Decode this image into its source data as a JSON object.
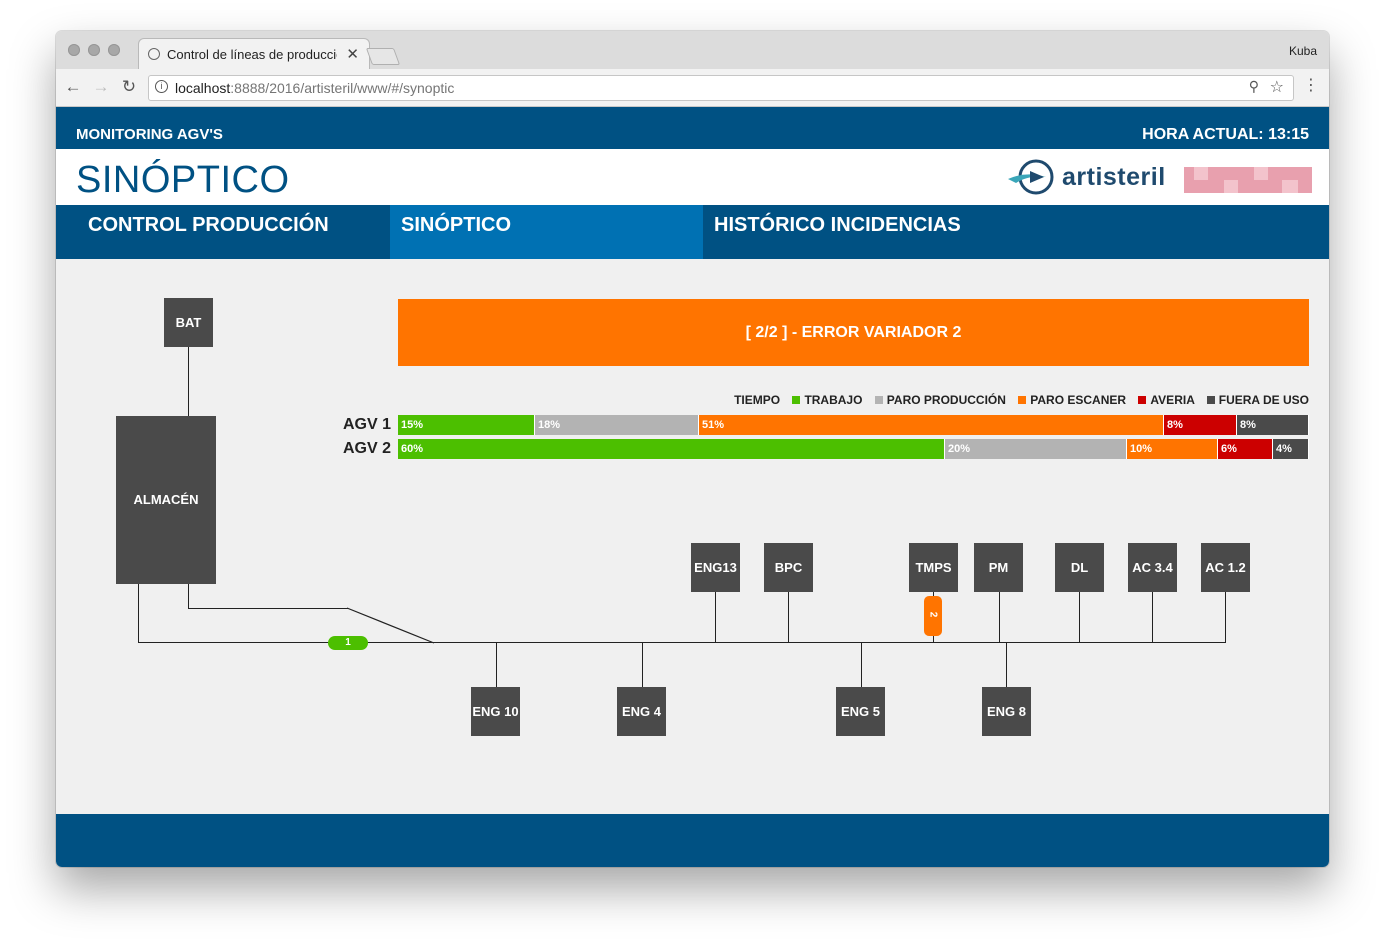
{
  "browser": {
    "tab_title": "Control de líneas de producción",
    "tab_close": "✕",
    "profile_name": "Kuba",
    "url_host": "localhost",
    "url_rest": ":8888/2016/artisteril/www/#/synoptic",
    "back_icon": "←",
    "forward_icon": "→",
    "reload_icon": "↻",
    "zoom_icon": "⚲",
    "star_icon": "☆",
    "menu_icon": "⋮",
    "info_icon": "i"
  },
  "header": {
    "app_name": "MONITORING AGV'S",
    "clock": "HORA ACTUAL: 13:15",
    "page_title": "SINÓPTICO",
    "logo_text": "artisteril"
  },
  "nav": {
    "tabs": [
      {
        "label": "CONTROL PRODUCCIÓN",
        "active": false
      },
      {
        "label": "SINÓPTICO",
        "active": true
      },
      {
        "label": "HISTÓRICO INCIDENCIAS",
        "active": false
      }
    ]
  },
  "alert": {
    "message": "[ 2/2 ] - ERROR VARIADOR 2",
    "color": "#ff7400"
  },
  "legend": {
    "title": "TIEMPO",
    "items": [
      {
        "label": "TRABAJO",
        "color": "#4cbf00"
      },
      {
        "label": "PARO PRODUCCIÓN",
        "color": "#b3b3b3"
      },
      {
        "label": "PARO ESCANER",
        "color": "#ff7400"
      },
      {
        "label": "AVERIA",
        "color": "#cc0000"
      },
      {
        "label": "FUERA DE USO",
        "color": "#4a4a4a"
      }
    ]
  },
  "agvs": [
    {
      "name": "AGV 1",
      "segments": [
        {
          "label": "15%",
          "value": 15,
          "color": "#4cbf00"
        },
        {
          "label": "18%",
          "value": 18,
          "color": "#b3b3b3"
        },
        {
          "label": "51%",
          "value": 51,
          "color": "#ff7400"
        },
        {
          "label": "8%",
          "value": 8,
          "color": "#cc0000"
        },
        {
          "label": "8%",
          "value": 8,
          "color": "#4a4a4a"
        }
      ]
    },
    {
      "name": "AGV 2",
      "segments": [
        {
          "label": "60%",
          "value": 60,
          "color": "#4cbf00"
        },
        {
          "label": "20%",
          "value": 20,
          "color": "#b3b3b3"
        },
        {
          "label": "10%",
          "value": 10,
          "color": "#ff7400"
        },
        {
          "label": "6%",
          "value": 6,
          "color": "#cc0000"
        },
        {
          "label": "4%",
          "value": 4,
          "color": "#4a4a4a"
        }
      ]
    }
  ],
  "stations": {
    "bat": "BAT",
    "almacen": "ALMACÉN",
    "eng13": "ENG13",
    "bpc": "BPC",
    "tmps": "TMPS",
    "pm": "PM",
    "dl": "DL",
    "ac34": "AC 3.4",
    "ac12": "AC 1.2",
    "eng10": "ENG 10",
    "eng4": "ENG 4",
    "eng5": "ENG 5",
    "eng8": "ENG 8"
  },
  "vehicles": [
    {
      "id": "1",
      "color": "#4cbf00"
    },
    {
      "id": "2",
      "color": "#ff7400"
    }
  ]
}
